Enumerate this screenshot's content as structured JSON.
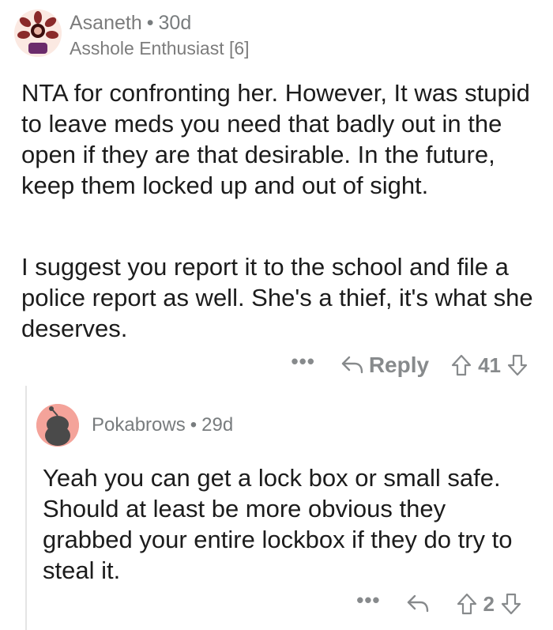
{
  "comment": {
    "username": "Asaneth",
    "separator": "•",
    "age": "30d",
    "flair": "Asshole Enthusiast [6]",
    "paragraphs": [
      "NTA for confronting her.  However, It was stupid to leave meds you need that badly out in the open if they are that desirable.  In the future, keep them locked up and out of sight.",
      "I suggest you report it to the school and file a police report as well.  She's a thief, it's what she deserves."
    ],
    "actions": {
      "more": "•••",
      "reply_label": "Reply",
      "score": "41"
    }
  },
  "reply": {
    "username": "Pokabrows",
    "separator": "•",
    "age": "29d",
    "body": "Yeah you can get a lock box or small safe. Should at least be more obvious they grabbed your entire lockbox if they do try to steal it.",
    "actions": {
      "more": "•••",
      "score": "2"
    }
  },
  "colors": {
    "text": "#1c1c1c",
    "meta": "#787c7e",
    "icon": "#878a8c",
    "thread_line": "#e5e5e5",
    "reply_avatar_bg": "#f4a39a"
  },
  "icons": [
    "demogorgon-avatar",
    "reply-arrow-icon",
    "upvote-icon",
    "downvote-icon",
    "snoo-avatar"
  ]
}
